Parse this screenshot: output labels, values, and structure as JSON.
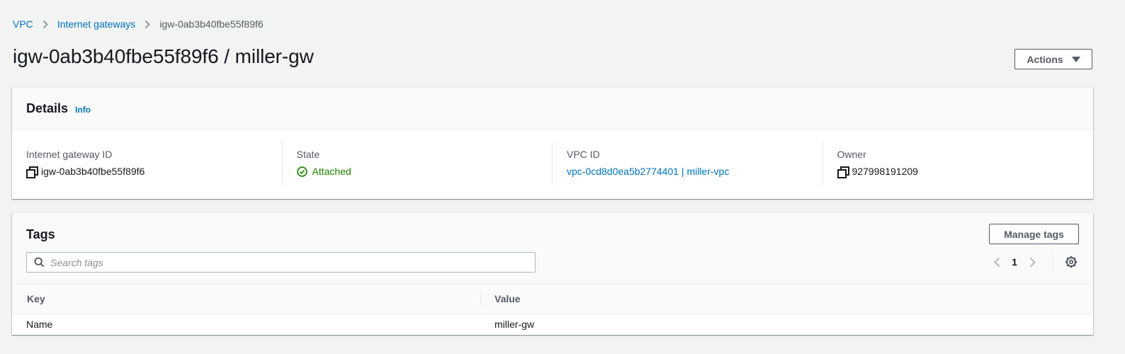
{
  "breadcrumb": {
    "items": [
      "VPC",
      "Internet gateways"
    ],
    "current": "igw-0ab3b40fbe55f89f6"
  },
  "header": {
    "title": "igw-0ab3b40fbe55f89f6 / miller-gw",
    "actions_label": "Actions"
  },
  "details": {
    "title": "Details",
    "info_label": "Info",
    "fields": [
      {
        "label": "Internet gateway ID",
        "value": "igw-0ab3b40fbe55f89f6",
        "icon": "copy-icon"
      },
      {
        "label": "State",
        "value": "Attached",
        "icon": "check-circle-icon",
        "status_color": "#1d8102"
      },
      {
        "label": "VPC ID",
        "value": "vpc-0cd8d0ea5b2774401 | miller-vpc"
      },
      {
        "label": "Owner",
        "value": "927998191209",
        "icon": "copy-icon"
      }
    ]
  },
  "tags": {
    "title": "Tags",
    "manage_label": "Manage tags",
    "search_placeholder": "Search tags",
    "page": "1",
    "columns": [
      "Key",
      "Value"
    ],
    "rows": [
      {
        "key": "Name",
        "value": "miller-gw"
      }
    ]
  },
  "colors": {
    "link": "#0073bb",
    "success": "#1d8102",
    "page_bg": "#f2f3f3"
  }
}
